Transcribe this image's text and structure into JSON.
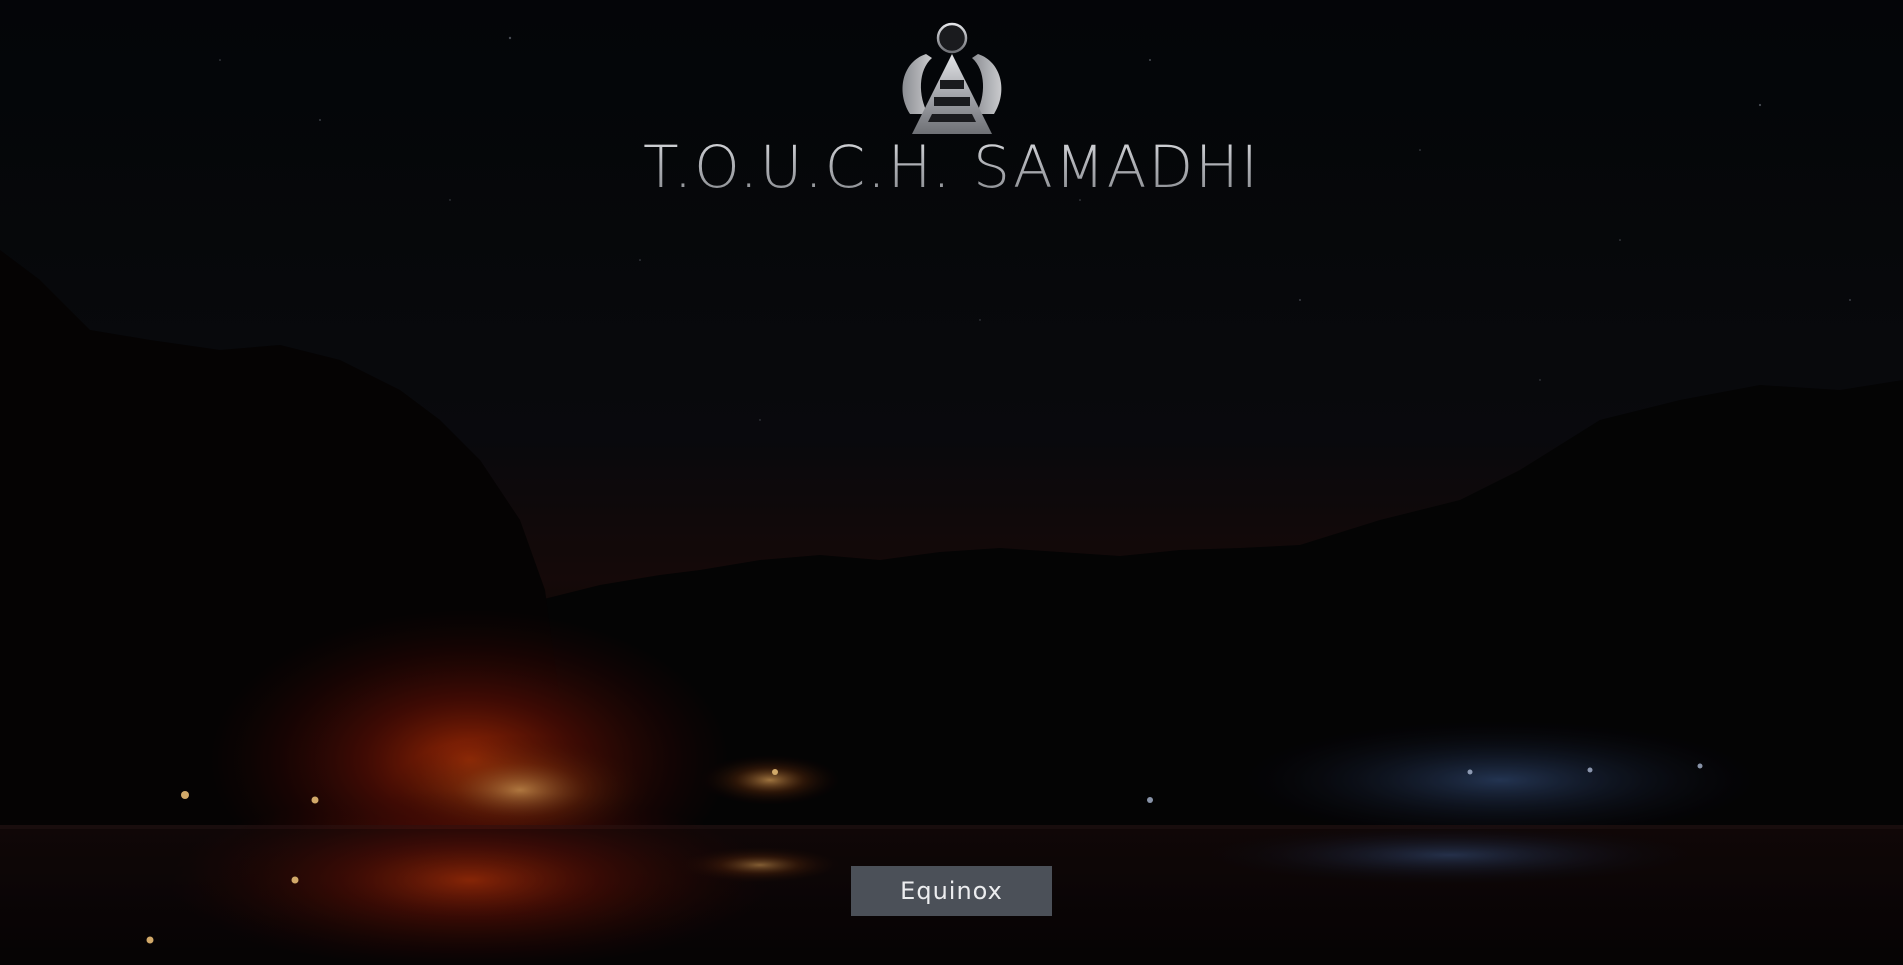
{
  "site": {
    "title": "T.O.U.C.H. SAMADHI",
    "logo_icon": "touch-samadhi-logo-icon"
  },
  "hero": {
    "background": "night-sky-lake-campfire-photo",
    "cta_label": "Equinox"
  },
  "colors": {
    "sky": "#05070a",
    "title_silver": "#b7b9be",
    "button_bg": "#4b5058",
    "button_text": "#ecedef",
    "fire_glow": "#b82200"
  }
}
